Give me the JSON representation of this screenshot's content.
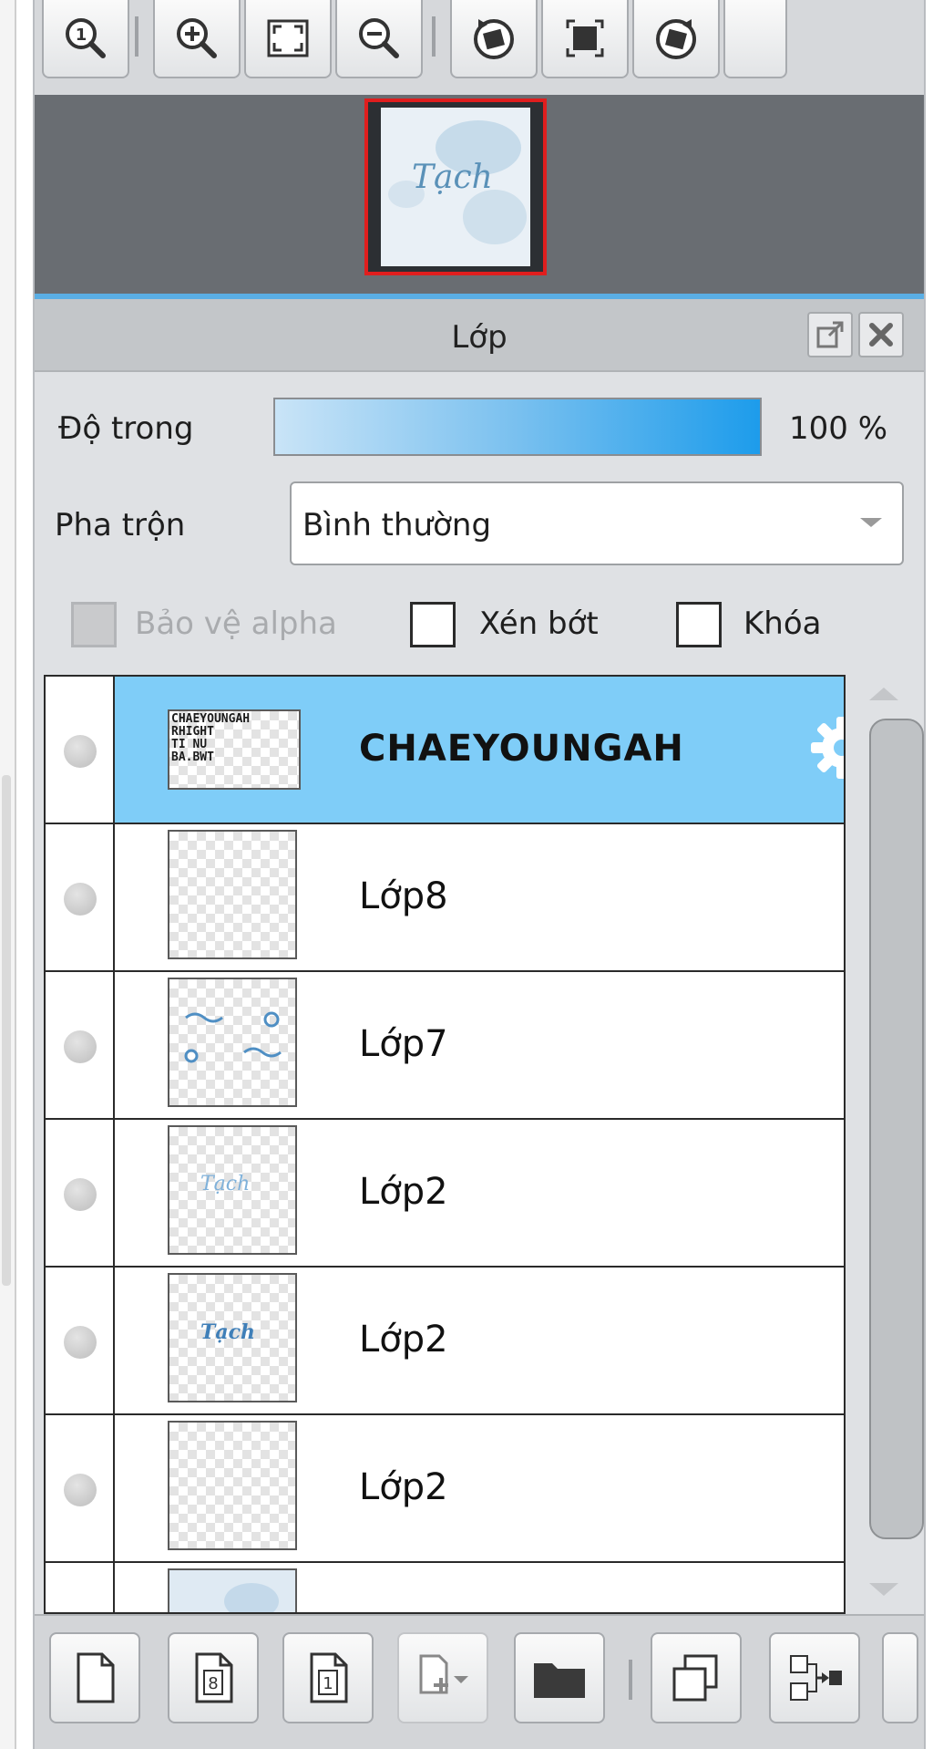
{
  "toolbar": {
    "buttons": [
      {
        "name": "zoom-actual-icon"
      },
      {
        "name": "zoom-in-icon"
      },
      {
        "name": "fit-screen-icon"
      },
      {
        "name": "zoom-out-icon"
      },
      {
        "name": "rotate-left-icon"
      },
      {
        "name": "reset-view-icon"
      },
      {
        "name": "rotate-right-icon"
      }
    ]
  },
  "navigator": {
    "thumbnail_text": "Tạch"
  },
  "layer_panel": {
    "title": "Lớp",
    "opacity_label": "Độ trong",
    "opacity_percent": 100,
    "opacity_value": "100 %",
    "blend_label": "Pha trộn",
    "blend_value": "Bình thường",
    "protect_alpha_label": "Bảo vệ alpha",
    "clipping_label": "Xén bớt",
    "lock_label": "Khóa"
  },
  "layers": [
    {
      "name": "CHAEYOUNGAH",
      "selected": true,
      "thumb_text": "CHAEYOUNGAH\nRHIGHT\nTI NU\nBA.BWT"
    },
    {
      "name": "Lớp8",
      "selected": false
    },
    {
      "name": "Lớp7",
      "selected": false
    },
    {
      "name": "Lớp2",
      "selected": false,
      "thumb_text": "Tạch"
    },
    {
      "name": "Lớp2",
      "selected": false,
      "thumb_text": "Tạch"
    },
    {
      "name": "Lớp2",
      "selected": false
    }
  ],
  "bottom_toolbar": {
    "buttons": [
      {
        "name": "new-layer-icon"
      },
      {
        "name": "new-8bit-layer-icon",
        "glyph": "8"
      },
      {
        "name": "new-1bit-layer-icon",
        "glyph": "1"
      },
      {
        "name": "add-layer-dropdown-icon"
      },
      {
        "name": "folder-icon"
      },
      {
        "name": "duplicate-layer-icon"
      },
      {
        "name": "merge-layer-icon"
      }
    ]
  },
  "colors": {
    "selected_row": "#7fcdf8",
    "opacity_bar": "#1d9ceb",
    "navigator_frame": "#e01e1e",
    "accent_line": "#5aaee4"
  }
}
